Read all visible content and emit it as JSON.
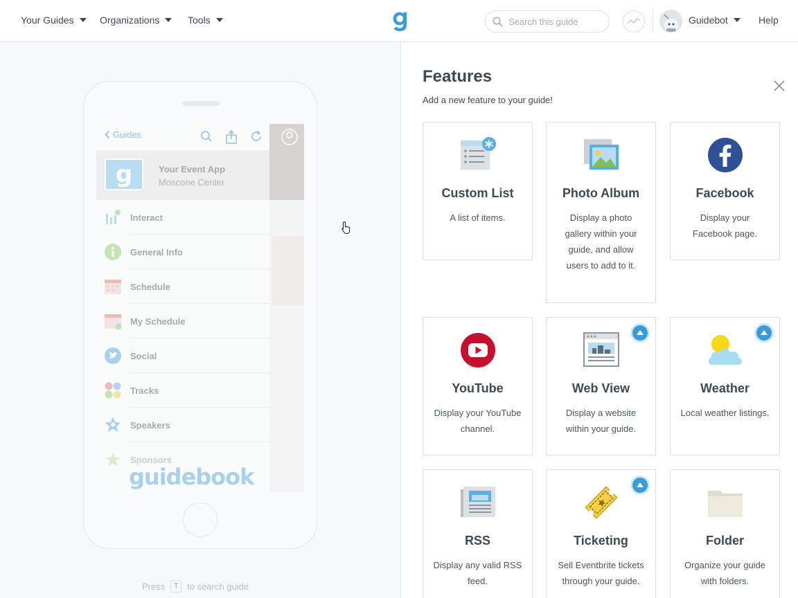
{
  "nav": {
    "your_guides": "Your Guides",
    "organizations": "Organizations",
    "tools": "Tools",
    "search_placeholder": "Search this guide",
    "user_name": "Guidebot",
    "help": "Help"
  },
  "preview": {
    "back_label": "Guides",
    "event_name": "Your Event App",
    "event_venue": "Moscone Center",
    "logo_letter": "g",
    "menu": [
      {
        "label": "Interact",
        "icon": "interact-icon"
      },
      {
        "label": "General Info",
        "icon": "info-icon"
      },
      {
        "label": "Schedule",
        "icon": "calendar-icon"
      },
      {
        "label": "My Schedule",
        "icon": "my-calendar-icon"
      },
      {
        "label": "Social",
        "icon": "twitter-icon"
      },
      {
        "label": "Tracks",
        "icon": "tracks-icon"
      },
      {
        "label": "Speakers",
        "icon": "star-icon"
      },
      {
        "label": "Sponsors",
        "icon": "sponsors-icon"
      }
    ],
    "watermark": "guidebook",
    "hint_prefix": "Press",
    "hint_key": "T",
    "hint_suffix": "to search guide"
  },
  "features": {
    "title": "Features",
    "subtitle": "Add a new feature to your guide!",
    "cards": [
      {
        "name": "Custom List",
        "desc": "A list of items.",
        "icon": "custom-list-icon",
        "upgrade": false
      },
      {
        "name": "Photo Album",
        "desc": "Display a photo gallery within your guide, and allow users to add to it.",
        "icon": "photo-album-icon",
        "upgrade": false
      },
      {
        "name": "Facebook",
        "desc": "Display your Facebook page.",
        "icon": "facebook-icon",
        "upgrade": false
      },
      {
        "name": "YouTube",
        "desc": "Display your YouTube channel.",
        "icon": "youtube-icon",
        "upgrade": false
      },
      {
        "name": "Web View",
        "desc": "Display a website within your guide.",
        "icon": "web-view-icon",
        "upgrade": true
      },
      {
        "name": "Weather",
        "desc": "Local weather listings.",
        "icon": "weather-icon",
        "upgrade": true
      },
      {
        "name": "RSS",
        "desc": "Display any valid RSS feed.",
        "icon": "rss-icon",
        "upgrade": false
      },
      {
        "name": "Ticketing",
        "desc": "Sell Eventbrite tickets through your guide.",
        "icon": "ticket-icon",
        "upgrade": true
      },
      {
        "name": "Folder",
        "desc": "Organize your guide with folders.",
        "icon": "folder-icon",
        "upgrade": false
      }
    ]
  },
  "colors": {
    "brand_blue": "#3a9bd9",
    "text": "#3c4a54",
    "facebook": "#2f4f97",
    "youtube": "#c4122e"
  }
}
